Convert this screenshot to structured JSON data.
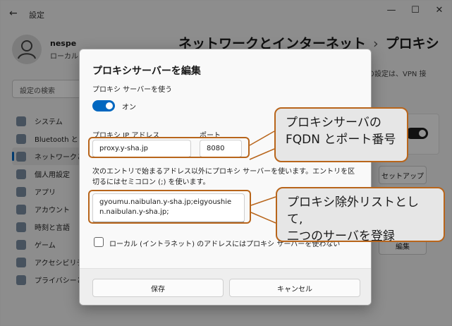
{
  "window": {
    "back_glyph": "←",
    "title": "設定",
    "controls": [
      "—",
      "☐",
      "✕"
    ]
  },
  "user": {
    "name": "nespe",
    "subtitle": "ローカル ア"
  },
  "search": {
    "placeholder": "設定の検索"
  },
  "nav": {
    "items": [
      {
        "label": "システム",
        "icon": "monitor-icon"
      },
      {
        "label": "Bluetooth と",
        "icon": "bluetooth-icon"
      },
      {
        "label": "ネットワークとイ",
        "icon": "wifi-icon",
        "active": true
      },
      {
        "label": "個人用設定",
        "icon": "brush-icon"
      },
      {
        "label": "アプリ",
        "icon": "apps-icon"
      },
      {
        "label": "アカウント",
        "icon": "person-icon"
      },
      {
        "label": "時刻と言語",
        "icon": "globe-clock-icon"
      },
      {
        "label": "ゲーム",
        "icon": "gamepad-icon"
      },
      {
        "label": "アクセシビリティ",
        "icon": "accessibility-icon"
      },
      {
        "label": "プライバシーとセキュリティ",
        "icon": "shield-icon"
      }
    ]
  },
  "breadcrumb": {
    "parent": "ネットワークとインターネット",
    "separator": "›",
    "current": "プロキシ"
  },
  "background": {
    "description": "の設定は、VPN 接",
    "setup_button": "セットアップ",
    "edit_button": "編集"
  },
  "dialog": {
    "title": "プロキシサーバーを編集",
    "use_proxy_label": "プロキシ サーバーを使う",
    "toggle_state": "オン",
    "ip_label": "プロキシ IP アドレス",
    "ip_value": "proxy.y-sha.jp",
    "port_label": "ポート",
    "port_value": "8080",
    "exceptions_desc": "次のエントリで始まるアドレス以外にプロキシ サーバーを使います。エントリを区切るにはセミコロン (;) を使います。",
    "exceptions_value": "gyoumu.naibulan.y-sha.jp;eigyoushien.naibulan.y-sha.jp;",
    "local_checkbox_label": "ローカル (イントラネット) のアドレスにはプロキシ サーバーを使わない",
    "save_button": "保存",
    "cancel_button": "キャンセル"
  },
  "callouts": {
    "proxy": "プロキシサーバの\nFQDN とポート番号",
    "exceptions": "プロキシ除外リストとして,\n二つのサーバを登録"
  },
  "colors": {
    "accent": "#0067c0",
    "callout_border": "#b8651b"
  }
}
